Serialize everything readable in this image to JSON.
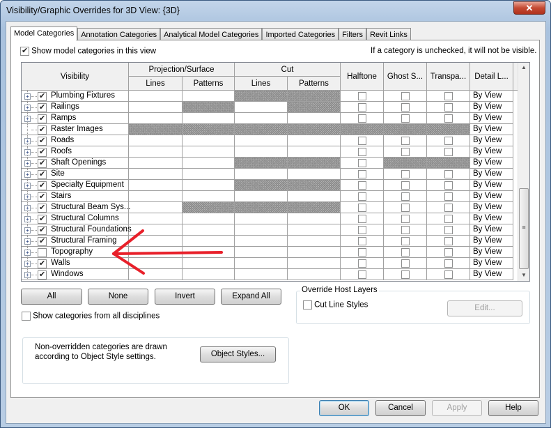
{
  "window": {
    "title": "Visibility/Graphic Overrides for 3D View: {3D}",
    "close": "✕"
  },
  "tabs": [
    "Model Categories",
    "Annotation Categories",
    "Analytical Model Categories",
    "Imported Categories",
    "Filters",
    "Revit Links"
  ],
  "show_model_categories": {
    "label": "Show model categories in this view",
    "checked": true
  },
  "hint": "If a category is unchecked, it will not be visible.",
  "headers": {
    "visibility": "Visibility",
    "projection": "Projection/Surface",
    "cut": "Cut",
    "lines": "Lines",
    "patterns": "Patterns",
    "halftone": "Halftone",
    "ghost": "Ghost S...",
    "transparent": "Transpa...",
    "detail": "Detail L..."
  },
  "rows": [
    {
      "name": "Plumbing Fixtures",
      "checked": true,
      "expandable": true,
      "hatched": [
        "cut_lines",
        "cut_patterns"
      ],
      "detail": "By View"
    },
    {
      "name": "Railings",
      "checked": true,
      "expandable": true,
      "hatched": [
        "proj_patterns",
        "cut_patterns"
      ],
      "detail": "By View"
    },
    {
      "name": "Ramps",
      "checked": true,
      "expandable": true,
      "hatched": [],
      "detail": "By View"
    },
    {
      "name": "Raster Images",
      "checked": true,
      "expandable": false,
      "hatched": [
        "proj_lines",
        "proj_patterns",
        "cut_lines",
        "cut_patterns",
        "halftone",
        "ghost",
        "transparent"
      ],
      "detail": "By View"
    },
    {
      "name": "Roads",
      "checked": true,
      "expandable": true,
      "hatched": [],
      "detail": "By View"
    },
    {
      "name": "Roofs",
      "checked": true,
      "expandable": true,
      "hatched": [],
      "detail": "By View"
    },
    {
      "name": "Shaft Openings",
      "checked": true,
      "expandable": true,
      "hatched": [
        "cut_lines",
        "cut_patterns",
        "ghost",
        "transparent"
      ],
      "detail": "By View"
    },
    {
      "name": "Site",
      "checked": true,
      "expandable": true,
      "hatched": [],
      "detail": "By View"
    },
    {
      "name": "Specialty Equipment",
      "checked": true,
      "expandable": true,
      "hatched": [
        "cut_lines",
        "cut_patterns"
      ],
      "detail": "By View"
    },
    {
      "name": "Stairs",
      "checked": true,
      "expandable": true,
      "hatched": [],
      "detail": "By View"
    },
    {
      "name": "Structural Beam Sys...",
      "checked": true,
      "expandable": true,
      "hatched": [
        "proj_patterns",
        "cut_lines",
        "cut_patterns"
      ],
      "detail": "By View"
    },
    {
      "name": "Structural Columns",
      "checked": true,
      "expandable": true,
      "hatched": [],
      "detail": "By View"
    },
    {
      "name": "Structural Foundations",
      "checked": true,
      "expandable": true,
      "hatched": [],
      "detail": "By View"
    },
    {
      "name": "Structural Framing",
      "checked": true,
      "expandable": true,
      "hatched": [],
      "detail": "By View"
    },
    {
      "name": "Topography",
      "checked": false,
      "expandable": true,
      "hatched": [],
      "detail": "By View"
    },
    {
      "name": "Walls",
      "checked": true,
      "expandable": true,
      "hatched": [],
      "detail": "By View"
    },
    {
      "name": "Windows",
      "checked": true,
      "expandable": true,
      "hatched": [],
      "detail": "By View"
    }
  ],
  "buttons": {
    "all": "All",
    "none": "None",
    "invert": "Invert",
    "expand_all": "Expand All",
    "object_styles": "Object Styles...",
    "edit": "Edit...",
    "ok": "OK",
    "cancel": "Cancel",
    "apply": "Apply",
    "help": "Help"
  },
  "show_all_disciplines": {
    "label": "Show categories from all disciplines",
    "checked": false
  },
  "override_host": {
    "title": "Override Host Layers",
    "cut_line_styles": "Cut Line Styles",
    "checked": false
  },
  "note": "Non-overridden categories are drawn according to Object Style settings.",
  "annotation_color": "#e8202a"
}
